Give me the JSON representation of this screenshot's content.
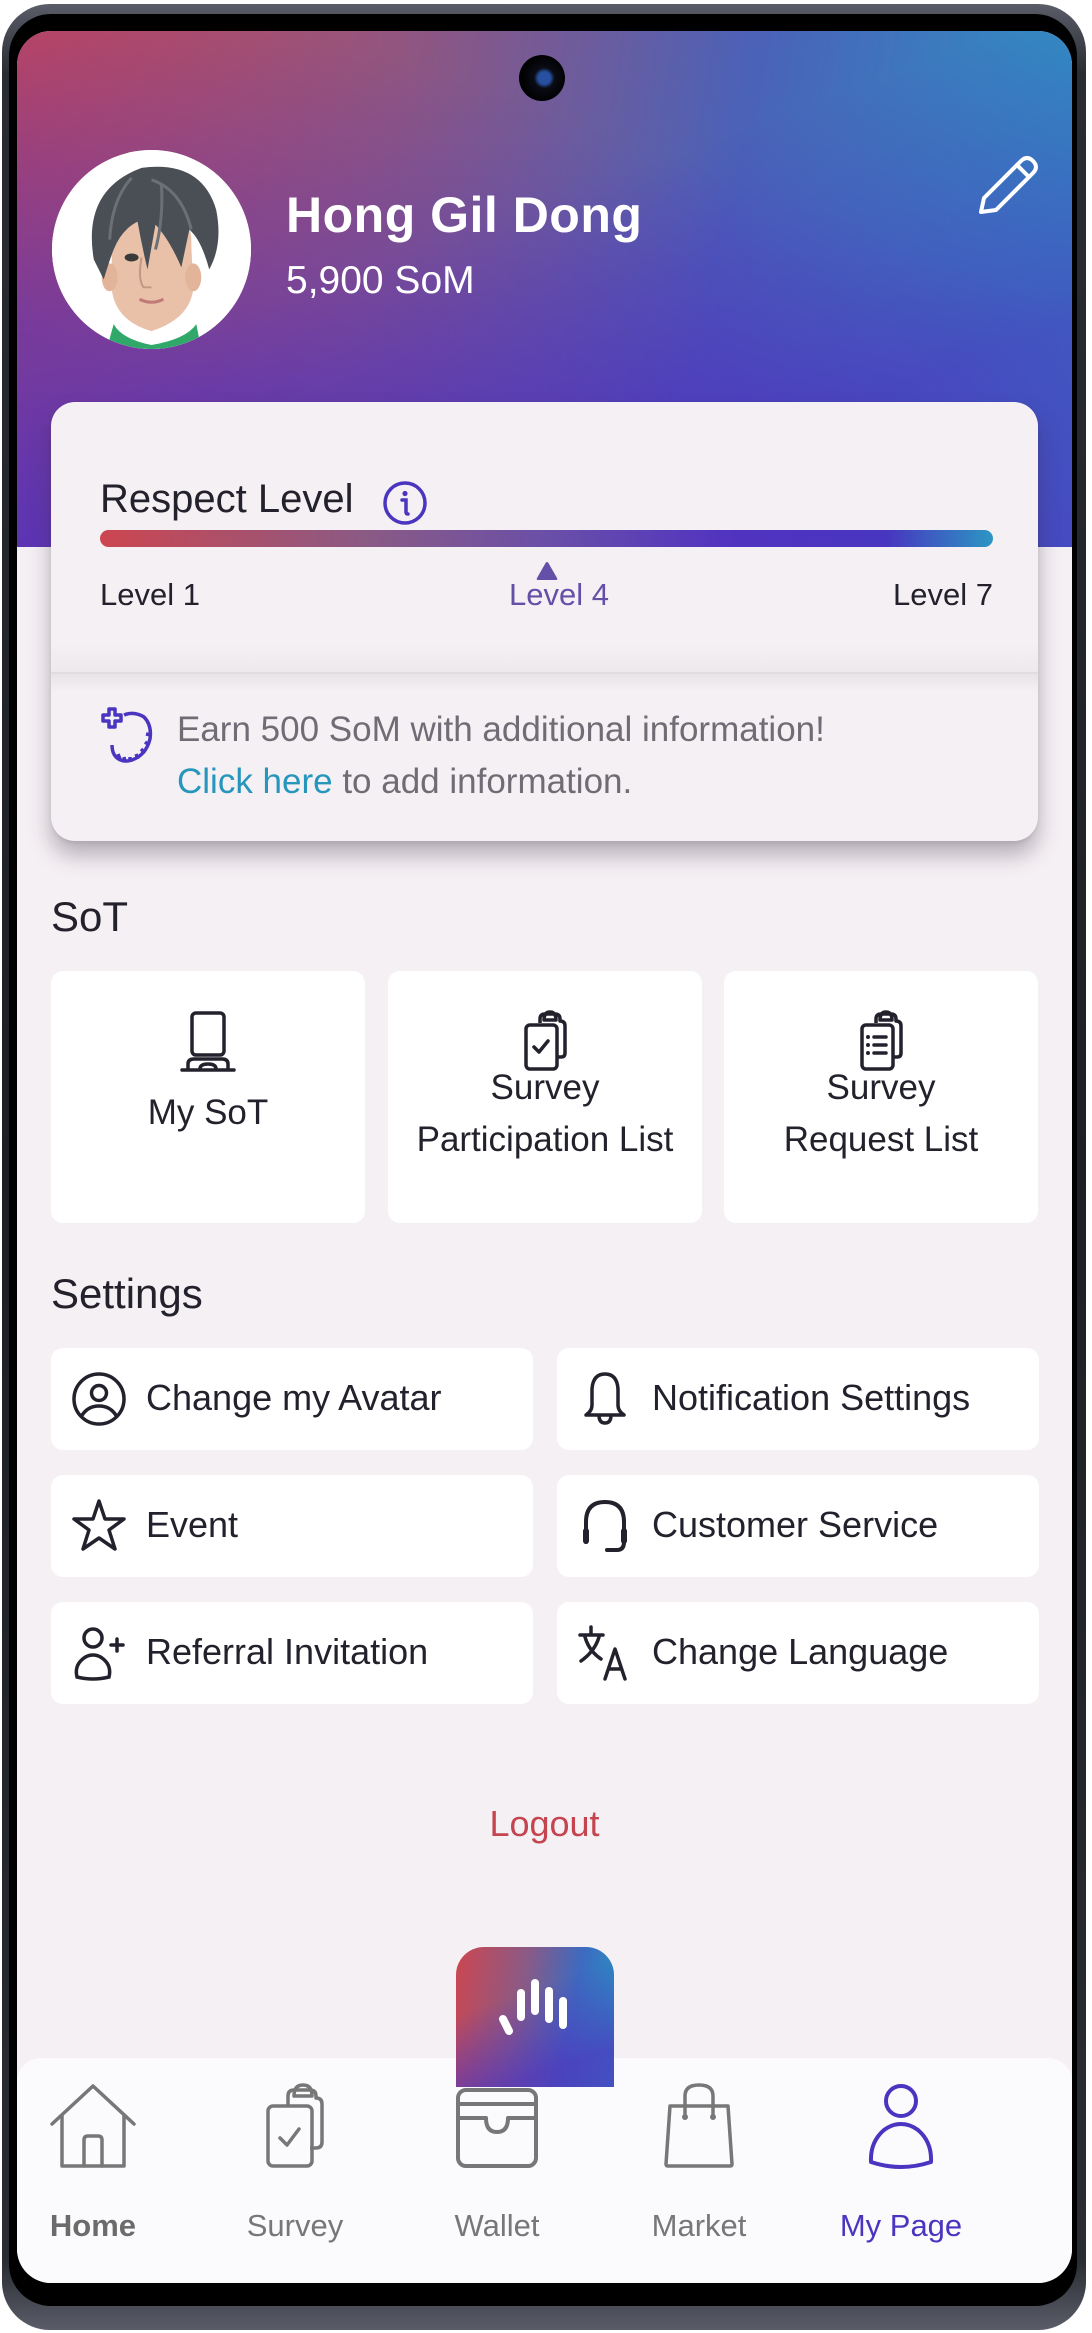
{
  "profile": {
    "name": "Hong Gil Dong",
    "balance": "5,900 SoM",
    "avatar_icon": "avatar-3d-character",
    "edit_icon": "pencil-icon"
  },
  "respect_level": {
    "title": "Respect Level",
    "info_icon": "info-icon",
    "min_label": "Level 1",
    "current_label": "Level 4",
    "max_label": "Level 7",
    "current_level": 4,
    "min_level": 1,
    "max_level": 7,
    "promo_icon": "coin-plus-icon",
    "promo_line1": "Earn 500 SoM with additional information!",
    "promo_link": "Click here",
    "promo_line2_rest": " to add information."
  },
  "sot": {
    "title": "SoT",
    "cards": [
      {
        "label_line1": "My SoT",
        "label_line2": "",
        "icon": "kiosk-device-icon"
      },
      {
        "label_line1": "Survey",
        "label_line2": "Participation List",
        "icon": "clipboard-check-icon"
      },
      {
        "label_line1": "Survey",
        "label_line2": "Request List",
        "icon": "clipboard-list-icon"
      }
    ]
  },
  "settings": {
    "title": "Settings",
    "items": [
      {
        "label": "Change my Avatar",
        "icon": "user-circle-icon"
      },
      {
        "label": "Notification Settings",
        "icon": "bell-icon"
      },
      {
        "label": "Event",
        "icon": "star-icon"
      },
      {
        "label": "Customer Service",
        "icon": "headset-icon"
      },
      {
        "label": "Referral Invitation",
        "icon": "user-plus-icon"
      },
      {
        "label": "Change Language",
        "icon": "translate-icon"
      }
    ]
  },
  "logout_label": "Logout",
  "center_button_icon": "hand-wave-icon",
  "bottom_nav": {
    "active": "My Page",
    "items": [
      {
        "label": "Home",
        "icon": "home-icon"
      },
      {
        "label": "Survey",
        "icon": "clipboard-check-icon"
      },
      {
        "label": "Wallet",
        "icon": "wallet-icon"
      },
      {
        "label": "Market",
        "icon": "shopping-bag-icon"
      },
      {
        "label": "My Page",
        "icon": "user-icon"
      }
    ]
  },
  "colors": {
    "accent_purple": "#4a35c0",
    "link_blue": "#2796bd",
    "logout_red": "#c4444f",
    "gradient_red": "#cc4852",
    "gradient_blue": "#2a98c4",
    "background": "#f5f0f4"
  }
}
